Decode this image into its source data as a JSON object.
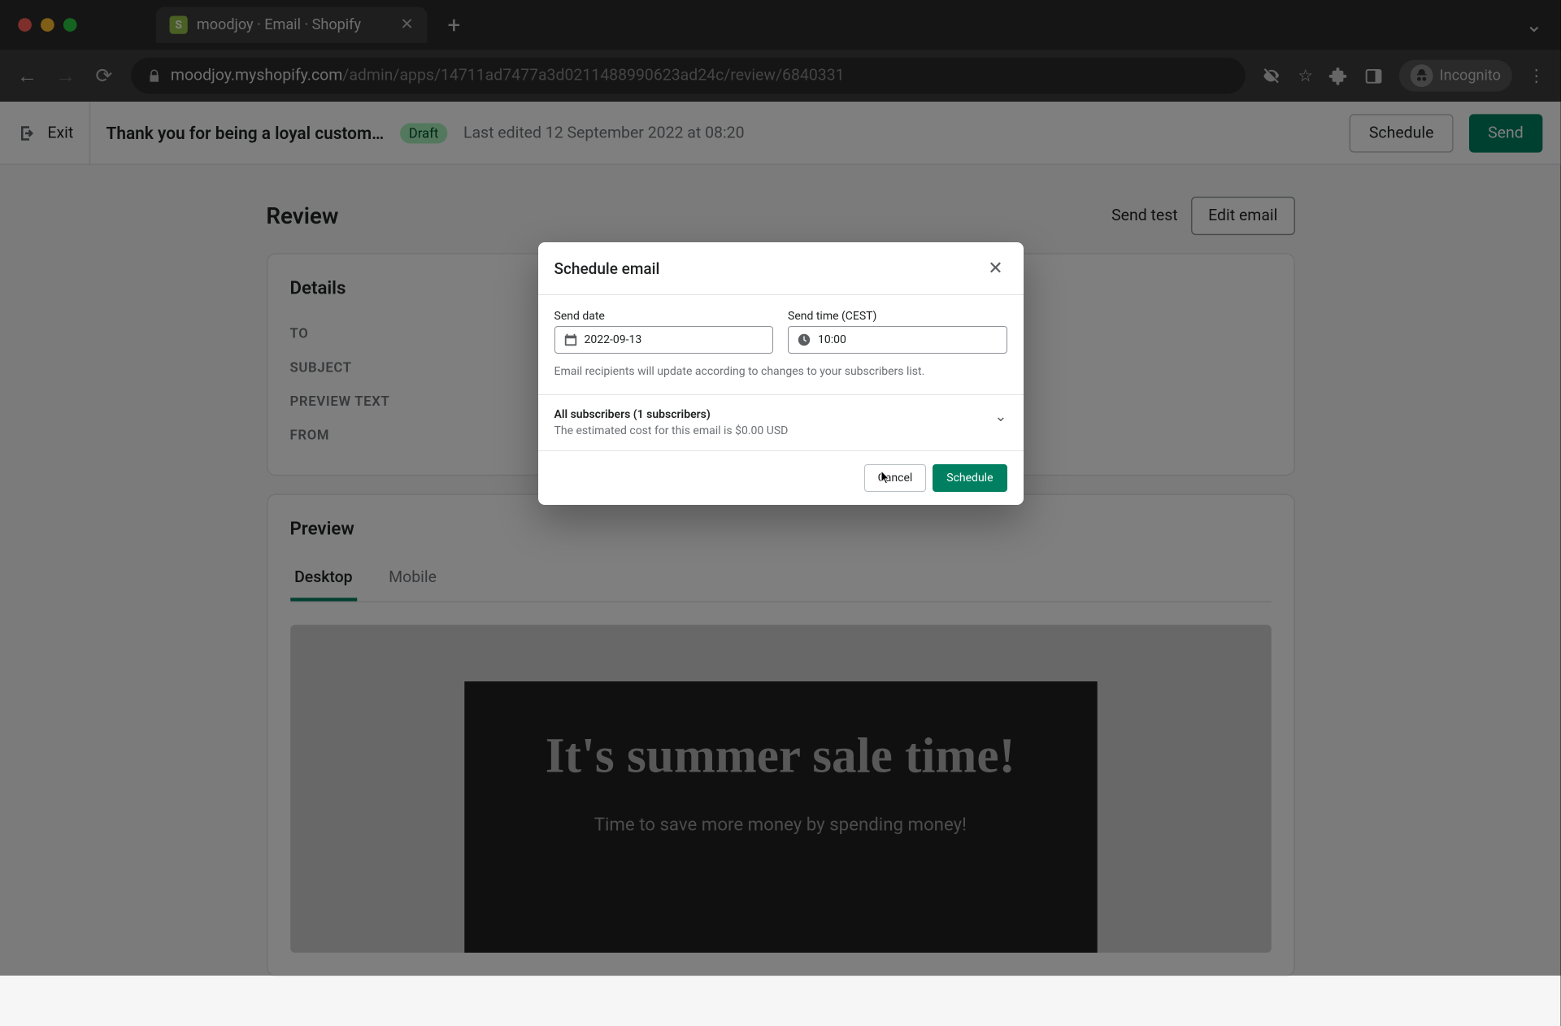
{
  "browser": {
    "tab_title": "moodjoy · Email · Shopify",
    "url_host": "moodjoy.myshopify.com",
    "url_path": "/admin/apps/14711ad7477a3d0211488990623ad24c/review/6840331",
    "incognito_label": "Incognito"
  },
  "header": {
    "exit_label": "Exit",
    "email_title": "Thank you for being a loyal custom…",
    "draft_badge": "Draft",
    "last_edited": "Last edited 12 September 2022 at 08:20",
    "schedule_btn": "Schedule",
    "send_btn": "Send"
  },
  "page": {
    "title": "Review",
    "send_test_btn": "Send test",
    "edit_email_btn": "Edit email"
  },
  "details": {
    "card_title": "Details",
    "labels": {
      "to": "TO",
      "subject": "SUBJECT",
      "preview_text": "PREVIEW TEXT",
      "from": "FROM"
    }
  },
  "preview": {
    "card_title": "Preview",
    "tabs": {
      "desktop": "Desktop",
      "mobile": "Mobile"
    },
    "email_heading": "It's summer sale time!",
    "email_sub": "Time to save more money by spending money!"
  },
  "modal": {
    "title": "Schedule email",
    "send_date_label": "Send date",
    "send_date_value": "2022-09-13",
    "send_time_label": "Send time (CEST)",
    "send_time_value": "10:00",
    "hint": "Email recipients will update according to changes to your subscribers list.",
    "subscribers_title": "All subscribers (1 subscribers)",
    "subscribers_cost": "The estimated cost for this email is $0.00 USD",
    "cancel_btn": "Cancel",
    "schedule_btn": "Schedule"
  }
}
